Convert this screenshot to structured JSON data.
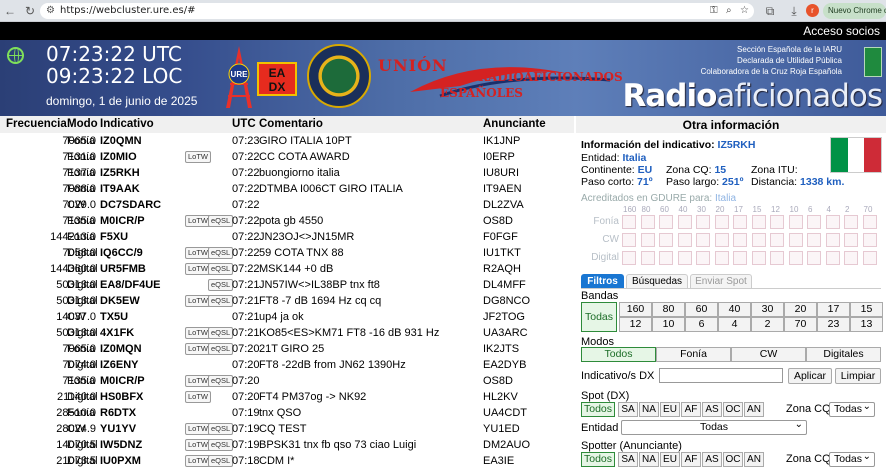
{
  "browser": {
    "url": "https://webcluster.ure.es/#",
    "avatar_letter": "r",
    "update_label": "Nuevo Chrome dispon"
  },
  "top": {
    "access_label": "Acceso socios"
  },
  "header": {
    "utc_time": "07:23:22 UTC",
    "loc_time": "09:23:22 LOC",
    "date": "domingo, 1 de junio de 2025",
    "logo_ure": "URE",
    "logo_eadx_1": "EA",
    "logo_eadx_2": "DX",
    "union_top": "UNIÓN",
    "union_mid": "RADIOAFICIONADOS",
    "union_bot": "ESPAÑOLES",
    "inst1": "Sección Española de la IARU",
    "inst2": "Declarada de Utilidad Pública",
    "inst3": "Colaboradora de la Cruz Roja Española",
    "brand_bold": "Radio",
    "brand_light": "aficionados"
  },
  "table": {
    "headers": {
      "freq": "Frecuencia",
      "mode": "Modo",
      "call": "Indicativo",
      "time": "UTC",
      "comment": "Comentario",
      "announcer": "Anunciante"
    },
    "lotw_label": "LoTW",
    "eqsl_label": "eQSL",
    "rows": [
      {
        "freq": "7065.0",
        "mode": "Fonía",
        "call": "IZ0QMN",
        "lotw": false,
        "eqsl": false,
        "time": "07:23",
        "comment": "GIRO ITALIA 10PT",
        "ann": "IK1JNP"
      },
      {
        "freq": "7131.0",
        "mode": "Fonía",
        "call": "IZ0MIO",
        "lotw": true,
        "eqsl": false,
        "time": "07:22",
        "comment": "CC COTA AWARD",
        "ann": "I0ERP"
      },
      {
        "freq": "7137.0",
        "mode": "Fonía",
        "call": "IZ5RKH",
        "lotw": false,
        "eqsl": false,
        "time": "07:22",
        "comment": "buongiorno italia",
        "ann": "IU8URI"
      },
      {
        "freq": "7088.0",
        "mode": "Fonía",
        "call": "IT9AAK",
        "lotw": false,
        "eqsl": false,
        "time": "07:22",
        "comment": "DTMBA I006CT GIRO ITALIA",
        "ann": "IT9AEN"
      },
      {
        "freq": "7029.0",
        "mode": "CW",
        "call": "DC7SDARC",
        "lotw": false,
        "eqsl": false,
        "time": "07:22",
        "comment": "",
        "ann": "DL2ZVA"
      },
      {
        "freq": "7135.0",
        "mode": "Fonía",
        "call": "M0ICR/P",
        "lotw": true,
        "eqsl": true,
        "time": "07:22",
        "comment": "pota gb 4550",
        "ann": "OS8D"
      },
      {
        "freq": "144213.0",
        "mode": "Fonía",
        "call": "F5XU",
        "lotw": false,
        "eqsl": false,
        "time": "07:22",
        "comment": "JN23OJ<>JN15MR",
        "ann": "F0FGF"
      },
      {
        "freq": "7058.0",
        "mode": "Digital",
        "call": "IQ6CC/9",
        "lotw": true,
        "eqsl": true,
        "time": "07:22",
        "comment": "59 COTA TNX 88",
        "ann": "IU1TKT"
      },
      {
        "freq": "144360.0",
        "mode": "Digital",
        "call": "UR5FMB",
        "lotw": true,
        "eqsl": true,
        "time": "07:22",
        "comment": "MSK144 +0 dB",
        "ann": "R2AQH"
      },
      {
        "freq": "50313.0",
        "mode": "Digital",
        "call": "EA8/DF4UE",
        "lotw": false,
        "eqsl": true,
        "time": "07:21",
        "comment": "JN57IW<>IL38BP tnx ft8",
        "ann": "DL4MFF"
      },
      {
        "freq": "50313.0",
        "mode": "Digital",
        "call": "DK5EW",
        "lotw": true,
        "eqsl": true,
        "time": "07:21",
        "comment": "FT8 -7 dB 1694 Hz cq cq",
        "ann": "DG8NCO"
      },
      {
        "freq": "14037.0",
        "mode": "CW",
        "call": "TX5U",
        "lotw": false,
        "eqsl": false,
        "time": "07:21",
        "comment": "up4 ja ok",
        "ann": "JF2TOG"
      },
      {
        "freq": "50313.0",
        "mode": "Digital",
        "call": "4X1FK",
        "lotw": true,
        "eqsl": true,
        "time": "07:21",
        "comment": "KO85<ES>KM71 FT8 -16 dB 931 Hz",
        "ann": "UA3ARC"
      },
      {
        "freq": "7065.0",
        "mode": "Fonía",
        "call": "IZ0MQN",
        "lotw": true,
        "eqsl": true,
        "time": "07:20",
        "comment": "21T GIRO 25",
        "ann": "IK2JTS"
      },
      {
        "freq": "7074.0",
        "mode": "Digital",
        "call": "IZ6ENY",
        "lotw": false,
        "eqsl": false,
        "time": "07:20",
        "comment": "FT8 -22dB from JN62 1390Hz",
        "ann": "EA2DYB"
      },
      {
        "freq": "7135.0",
        "mode": "Fonía",
        "call": "M0ICR/P",
        "lotw": true,
        "eqsl": true,
        "time": "07:20",
        "comment": "",
        "ann": "OS8D"
      },
      {
        "freq": "21140.0",
        "mode": "Digital",
        "call": "HS0BFX",
        "lotw": true,
        "eqsl": false,
        "time": "07:20",
        "comment": "FT4 PM37og -> NK92",
        "ann": "HL2KV"
      },
      {
        "freq": "28510.0",
        "mode": "Fonía",
        "call": "R6DTX",
        "lotw": false,
        "eqsl": false,
        "time": "07:19",
        "comment": "tnx QSO",
        "ann": "UA4CDT"
      },
      {
        "freq": "28024.9",
        "mode": "CW",
        "call": "YU1YV",
        "lotw": true,
        "eqsl": true,
        "time": "07:19",
        "comment": "CQ TEST",
        "ann": "YU1ED"
      },
      {
        "freq": "14070.5",
        "mode": "Digital",
        "call": "IW5DNZ",
        "lotw": true,
        "eqsl": true,
        "time": "07:19",
        "comment": "BPSK31 tnx fb qso 73 ciao Luigi",
        "ann": "DM2AUO"
      },
      {
        "freq": "21073.5",
        "mode": "Digital",
        "call": "IU0PXM",
        "lotw": true,
        "eqsl": true,
        "time": "07:18",
        "comment": "CDM I*",
        "ann": "EA3IE"
      }
    ]
  },
  "info": {
    "title": "Otra información",
    "label_call": "Información del indicativo:",
    "call": "IZ5RKH",
    "label_entity": "Entidad:",
    "entity": "Italia",
    "label_continent": "Continente:",
    "continent": "EU",
    "label_cq": "Zona CQ:",
    "cq": "15",
    "label_itu": "Zona ITU:",
    "itu": "",
    "label_short": "Paso corto:",
    "short_path": "71º",
    "label_long": "Paso largo:",
    "long_path": "251º",
    "label_dist": "Distancia:",
    "distance": "1338 km.",
    "flag_colors": [
      "#009246",
      "#ffffff",
      "#ce2b37"
    ],
    "gdure_label": "Acreditados en GDURE para:",
    "gdure_entity": "Italia",
    "bands_header": [
      "160",
      "80",
      "60",
      "40",
      "30",
      "20",
      "17",
      "15",
      "12",
      "10",
      "6",
      "4",
      "2",
      "70"
    ],
    "mode_rows": [
      "Fonía",
      "CW",
      "Digital"
    ]
  },
  "filters": {
    "tabs": [
      "Filtros",
      "Búsquedas",
      "Enviar Spot"
    ],
    "bands_label": "Bandas",
    "bands_all": "Todas",
    "bands_row1": [
      "160",
      "80",
      "60",
      "40",
      "30",
      "20",
      "17",
      "15"
    ],
    "bands_row2": [
      "12",
      "10",
      "6",
      "4",
      "2",
      "70",
      "23",
      "13"
    ],
    "modes_label": "Modos",
    "modes": [
      "Todos",
      "Fonía",
      "CW",
      "Digitales"
    ],
    "dx_label": "Indicativo/s DX",
    "apply": "Aplicar",
    "clear": "Limpiar",
    "spot_label": "Spot (DX)",
    "continents_all": "Todos",
    "continents": [
      "SA",
      "NA",
      "EU",
      "AF",
      "AS",
      "OC",
      "AN"
    ],
    "cq_zone_label": "Zona CQ",
    "cq_zone_value": "Todas",
    "entity_label": "Entidad",
    "entity_value": "Todas",
    "spotter_label": "Spotter (Anunciante)"
  }
}
